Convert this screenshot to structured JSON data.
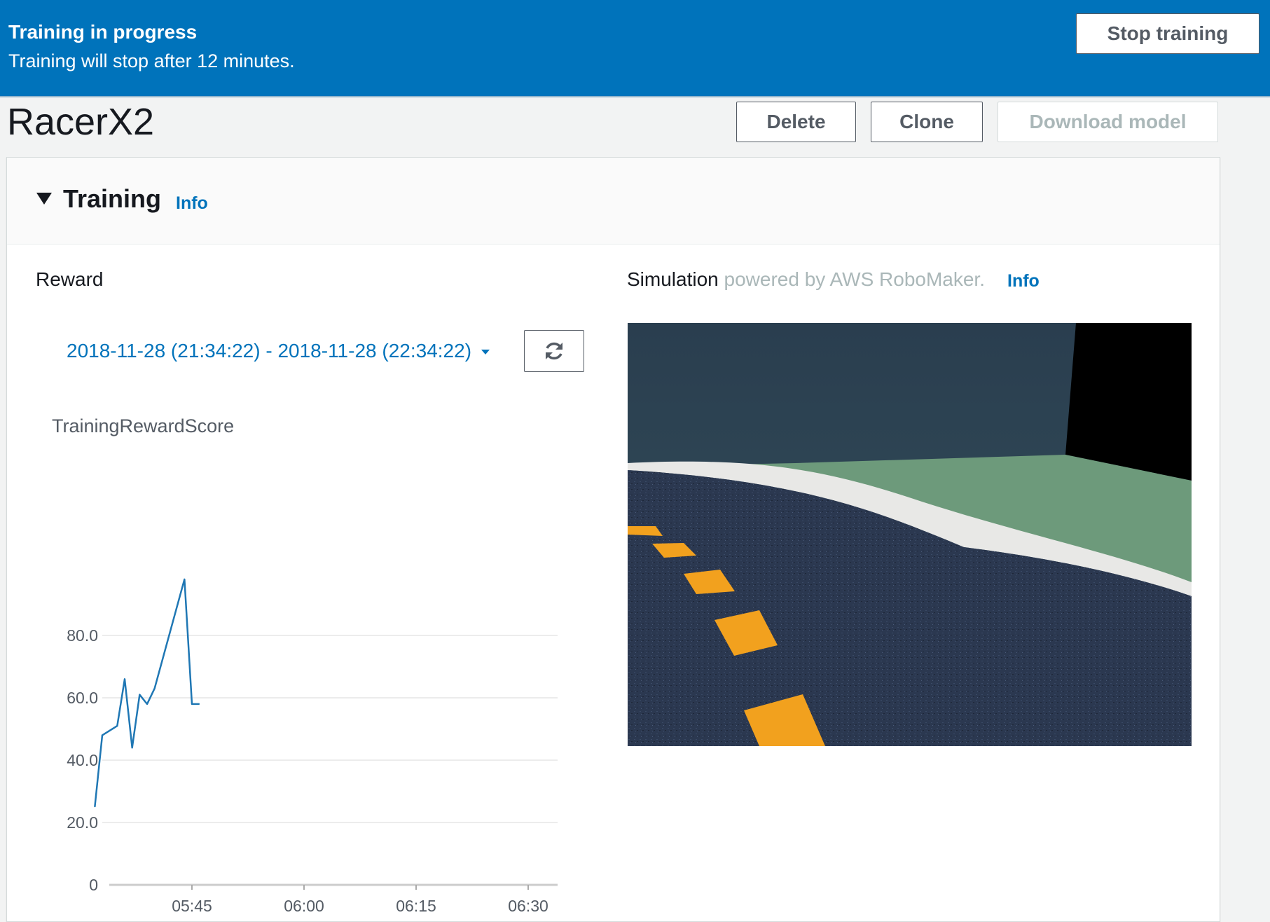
{
  "banner": {
    "title": "Training in progress",
    "message": "Training will stop after 12 minutes.",
    "stop_label": "Stop training"
  },
  "header": {
    "title": "RacerX2",
    "delete_label": "Delete",
    "clone_label": "Clone",
    "download_label": "Download model"
  },
  "training": {
    "title": "Training",
    "info_label": "Info"
  },
  "reward": {
    "title": "Reward",
    "date_range": "2018-11-28 (21:34:22) - 2018-11-28 (22:34:22)",
    "chart_title": "TrainingRewardScore"
  },
  "simulation": {
    "title": "Simulation",
    "subtitle": "powered by AWS RoboMaker.",
    "info_label": "Info"
  },
  "colors": {
    "banner": "#0073bb",
    "link": "#0073bb",
    "series": "#1f77b4",
    "track_asphalt": "#2d3b52",
    "track_lane": "#f2a11e",
    "grass": "#6e9b7c",
    "wall": "#2f4454"
  },
  "chart_data": {
    "type": "line",
    "title": "TrainingRewardScore",
    "xlabel": "",
    "ylabel": "",
    "ylim": [
      0,
      100
    ],
    "y_ticks": [
      "0",
      "20.0",
      "40.0",
      "60.0",
      "80.0"
    ],
    "x_ticks": [
      "05:45",
      "06:00",
      "06:15",
      "06:30"
    ],
    "grid": true,
    "series": [
      {
        "x": [
          "05:32",
          "05:33",
          "05:35",
          "05:36",
          "05:37",
          "05:38",
          "05:39",
          "05:40",
          "05:44",
          "05:45",
          "05:46"
        ],
        "values": [
          25,
          48,
          51,
          66,
          44,
          61,
          58,
          63,
          98,
          58,
          58
        ]
      }
    ]
  }
}
